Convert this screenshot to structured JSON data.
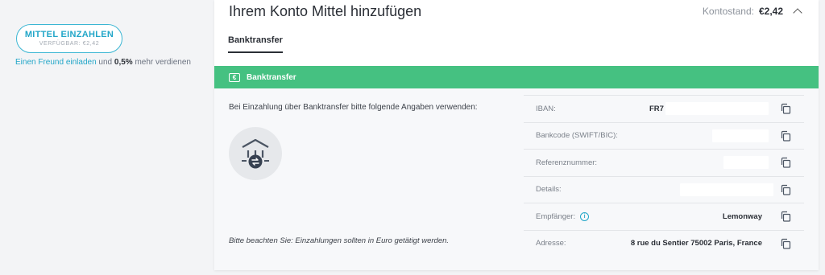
{
  "sidebar": {
    "deposit_button_label": "MITTEL EINZAHLEN",
    "available_label": "VERFÜGBAR: €2,42",
    "invite_link": "Einen Freund einladen",
    "invite_and": "und",
    "invite_percent": "0,5%",
    "invite_rest": "mehr verdienen"
  },
  "card": {
    "title": "Ihrem Konto Mittel hinzufügen",
    "balance_label": "Kontostand:",
    "balance_value": "€2,42",
    "tab_label": "Banktransfer",
    "bar_label": "Banktransfer",
    "euro_symbol": "€",
    "instructions": "Bei Einzahlung über Banktransfer bitte folgende Angaben verwenden:",
    "note": "Bitte beachten Sie: Einzahlungen sollten in Euro getätigt werden."
  },
  "details": [
    {
      "key": "IBAN:",
      "value": "FR7"
    },
    {
      "key": "Bankcode (SWIFT/BIC):",
      "value": ""
    },
    {
      "key": "Referenznummer:",
      "value": ""
    },
    {
      "key": "Details:",
      "value": ""
    },
    {
      "key": "Empfänger:",
      "value": "Lemonway"
    },
    {
      "key": "Adresse:",
      "value": "8 rue du Sentier 75002 Paris, France"
    }
  ],
  "icons": {
    "copy": "copy-icon",
    "info": "info-icon",
    "bank": "bank-transfer-icon",
    "euro": "euro-icon",
    "chevron": "chevron-up-icon"
  },
  "colors": {
    "accent": "#22a6c8",
    "green_bar": "#45c181"
  }
}
